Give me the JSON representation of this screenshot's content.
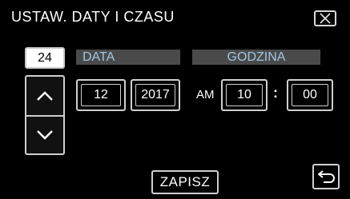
{
  "header": {
    "title": "USTAW. DATY I CZASU"
  },
  "date_section": {
    "label": "DATA",
    "day": "24",
    "month": "12",
    "year": "2017"
  },
  "time_section": {
    "label": "GODZINA",
    "ampm": "AM",
    "hour": "10",
    "separator": ":",
    "minute": "00"
  },
  "footer": {
    "save_label": "ZAPISZ"
  },
  "icons": {
    "close": "close-icon",
    "up": "chevron-up-icon",
    "down": "chevron-down-icon",
    "back": "return-arrow-icon"
  },
  "colors": {
    "section_label_text": "#9fc7e2",
    "section_label_bg": "#4a4a4a"
  }
}
